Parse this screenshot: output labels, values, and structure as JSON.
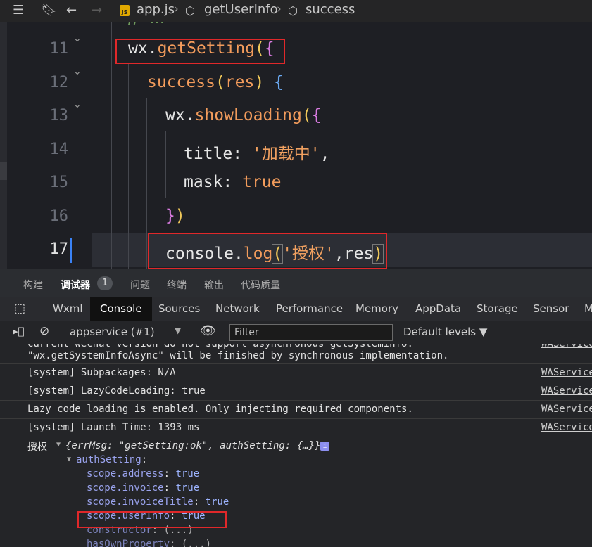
{
  "breadcrumb": {
    "file": "app.js",
    "func1": "getUserInfo",
    "func2": "success",
    "js_badge": "JS"
  },
  "editor": {
    "line_numbers": [
      "11",
      "12",
      "13",
      "14",
      "15",
      "16",
      "17"
    ],
    "line11": {
      "obj": "wx",
      "dot": ".",
      "fn": "getSetting",
      "paren": "(",
      "brace": "{"
    },
    "line12": {
      "fn": "success",
      "open": "(",
      "arg": "res",
      "close": ")",
      "brace": " {"
    },
    "line13": {
      "obj": "wx",
      "dot": ".",
      "fn": "showLoading",
      "paren": "(",
      "brace": "{"
    },
    "line14": {
      "key": "title: ",
      "str": "'加载中'",
      "comma": ","
    },
    "line15": {
      "key": "mask: ",
      "val": "true"
    },
    "line16": {
      "brace": "}",
      "paren": ")"
    },
    "line17": {
      "obj": "console",
      "dot": ".",
      "fn": "log",
      "open": "(",
      "str": "'授权'",
      "rest": ",res",
      "close": ")"
    }
  },
  "panel_tabs": [
    "构建",
    "调试器",
    "问题",
    "终端",
    "输出",
    "代码质量"
  ],
  "panel_badge": "1",
  "devtools_tabs": [
    "Wxml",
    "Console",
    "Sources",
    "Network",
    "Performance",
    "Memory",
    "AppData",
    "Storage",
    "Sensor",
    "M"
  ],
  "console_toolbar": {
    "context": "appservice (#1)",
    "filter_placeholder": "Filter",
    "levels": "Default levels ▼"
  },
  "console": {
    "rows": [
      {
        "msg": "current wechat version do not support asynchronous getSystemInfo.",
        "src": "WAService"
      },
      {
        "msg": "\"wx.getSystemInfoAsync\" will be finished by synchronous implementation.",
        "src": ""
      },
      {
        "msg": "[system] Subpackages: N/A",
        "src": "WAService"
      },
      {
        "msg": "[system] LazyCodeLoading: true",
        "src": "WAService"
      },
      {
        "msg": "Lazy code loading is enabled. Only injecting required components.",
        "src": "WAService"
      },
      {
        "msg": "[system] Launch Time: 1393 ms",
        "src": "WAService"
      }
    ],
    "log_label": "授权",
    "obj_summary": "{errMsg: \"getSetting:ok\", authSetting: {…}}",
    "auth_key": "authSetting",
    "props": [
      {
        "k": "scope.address",
        "v": "true"
      },
      {
        "k": "scope.invoice",
        "v": "true"
      },
      {
        "k": "scope.invoiceTitle",
        "v": "true"
      },
      {
        "k": "scope.userInfo",
        "v": "true"
      },
      {
        "k": "constructor",
        "v": "(...)"
      },
      {
        "k": "hasOwnProperty",
        "v": "(...)"
      }
    ]
  }
}
